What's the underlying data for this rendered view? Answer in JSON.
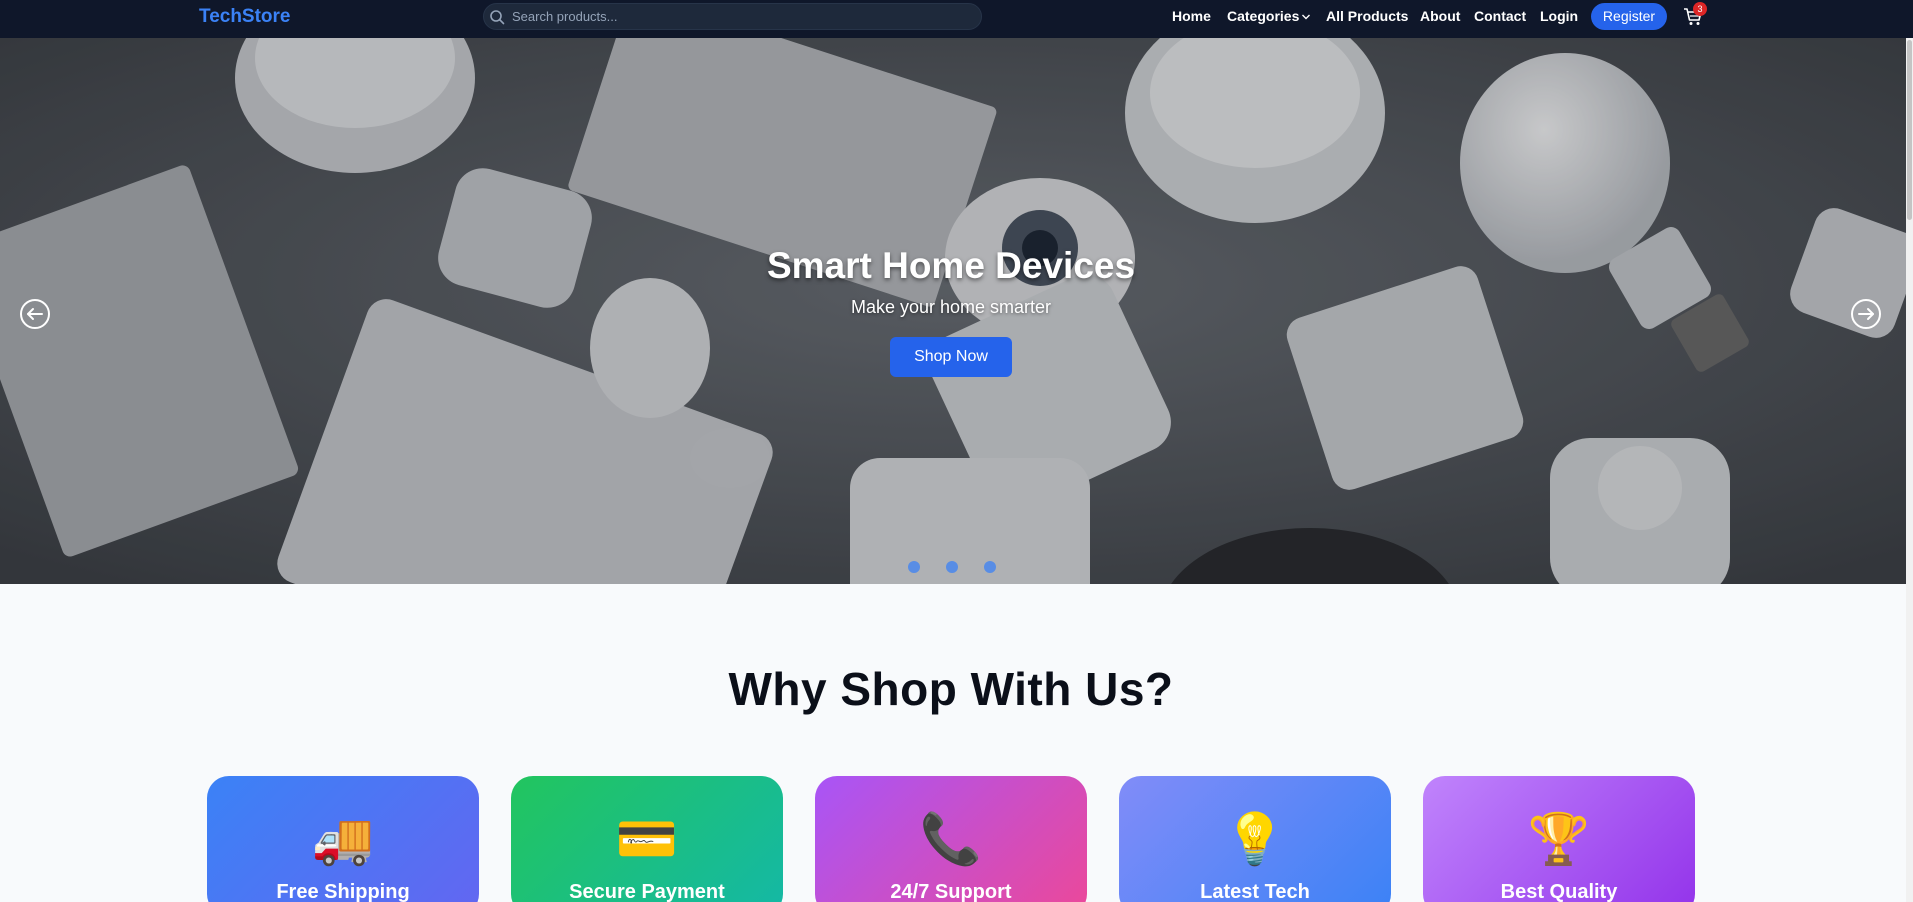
{
  "nav": {
    "brand": "TechStore",
    "search_placeholder": "Search products...",
    "links": {
      "home": "Home",
      "categories": "Categories",
      "all_products": "All Products",
      "about": "About",
      "contact": "Contact",
      "login": "Login"
    },
    "register": "Register",
    "cart_count": "3"
  },
  "hero": {
    "title": "Smart Home Devices",
    "subtitle": "Make your home smarter",
    "button": "Shop Now",
    "slide_count": 3,
    "active_slide": 1
  },
  "features": {
    "title": "Why Shop With Us?",
    "cards": [
      {
        "icon": "🚚",
        "icon_name": "truck-icon",
        "title": "Free Shipping",
        "gradient": [
          "#3b82f6",
          "#6366f1"
        ]
      },
      {
        "icon": "💳",
        "icon_name": "credit-card-icon",
        "title": "Secure Payment",
        "gradient": [
          "#22c55e",
          "#14b8a6"
        ]
      },
      {
        "icon": "📞",
        "icon_name": "phone-icon",
        "title": "24/7 Support",
        "gradient": [
          "#a855f7",
          "#ec4899"
        ]
      },
      {
        "icon": "💡",
        "icon_name": "lightbulb-icon",
        "title": "Latest Tech",
        "gradient": [
          "#818cf8",
          "#3b82f6"
        ]
      },
      {
        "icon": "🏆",
        "icon_name": "trophy-icon",
        "title": "Best Quality",
        "gradient": [
          "#c084fc",
          "#9333ea"
        ]
      }
    ]
  },
  "colors": {
    "nav_bg": "#0f172a",
    "brand": "#3b82f6",
    "primary": "#2563eb",
    "badge": "#dc2626",
    "page_bg": "#f8fafc"
  }
}
